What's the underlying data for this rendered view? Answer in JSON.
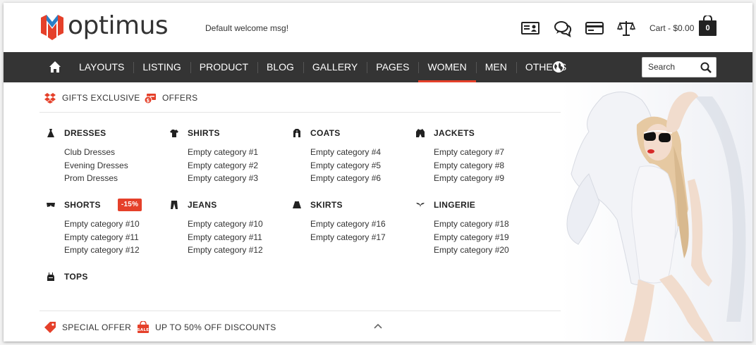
{
  "header": {
    "brand": "optimus",
    "welcome": "Default welcome msg!",
    "cart_label": "Cart - $0.00",
    "cart_count": "0",
    "icons": [
      "contact-card-icon",
      "chat-bubbles-icon",
      "credit-card-icon",
      "compare-scales-icon"
    ]
  },
  "nav": {
    "items": [
      "LAYOUTS",
      "LISTING",
      "PRODUCT",
      "BLOG",
      "GALLERY",
      "PAGES",
      "WOMEN",
      "MEN",
      "OTHERS"
    ],
    "active_index": 6,
    "search_placeholder": "Search"
  },
  "mega": {
    "top_links": [
      "GIFTS EXCLUSIVE",
      "OFFERS"
    ],
    "categories": [
      {
        "title": "DRESSES",
        "icon": "dress-icon",
        "items": [
          "Club Dresses",
          "Evening Dresses",
          "Prom Dresses"
        ]
      },
      {
        "title": "SHIRTS",
        "icon": "tshirt-icon",
        "items": [
          "Empty category #1",
          "Empty category #2",
          "Empty category #3"
        ]
      },
      {
        "title": "COATS",
        "icon": "coat-icon",
        "items": [
          "Empty category #4",
          "Empty category #5",
          "Empty category #6"
        ]
      },
      {
        "title": "JACKETS",
        "icon": "jacket-icon",
        "items": [
          "Empty category #7",
          "Empty category #8",
          "Empty category #9"
        ]
      },
      {
        "title": "SHORTS",
        "icon": "shorts-icon",
        "badge": "-15%",
        "items": [
          "Empty category #10",
          "Empty category #11",
          "Empty category #12"
        ]
      },
      {
        "title": "JEANS",
        "icon": "jeans-icon",
        "items": [
          "Empty category #10",
          "Empty category #11",
          "Empty category #12"
        ]
      },
      {
        "title": "SKIRTS",
        "icon": "skirt-icon",
        "items": [
          "Empty category #16",
          "Empty category #17"
        ]
      },
      {
        "title": "LINGERIE",
        "icon": "lingerie-icon",
        "items": [
          "Empty category #18",
          "Empty category #19",
          "Empty category #20"
        ]
      },
      {
        "title": "TOPS",
        "icon": "top-icon",
        "items": []
      }
    ],
    "bottom_links": [
      "SPECIAL OFFER",
      "UP TO 50% OFF DISCOUNTS"
    ],
    "sale_tag": "SALE"
  },
  "colors": {
    "accent": "#e5402a",
    "nav_bg": "#343434",
    "text": "#333333"
  }
}
